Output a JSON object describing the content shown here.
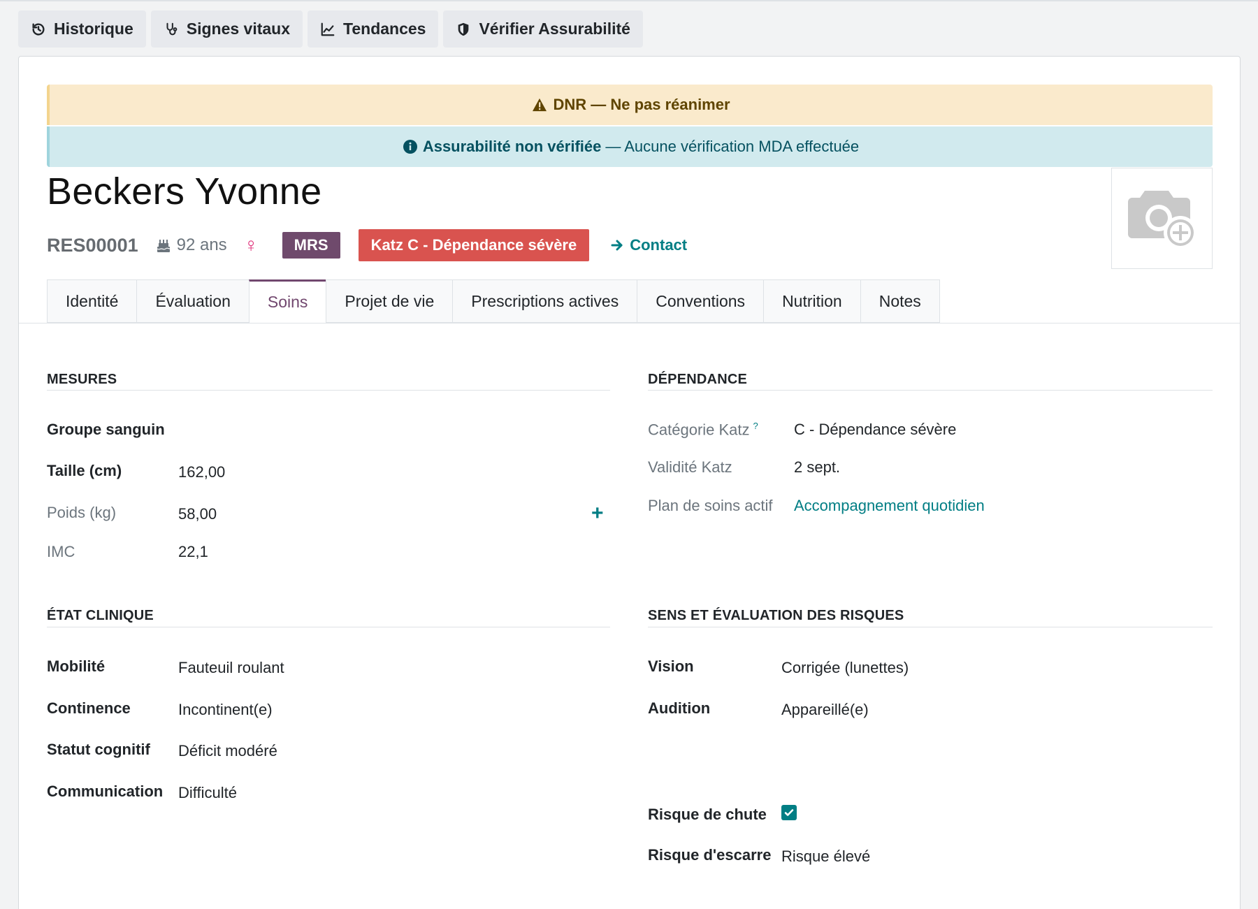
{
  "toolbar": {
    "history": "Historique",
    "vitals": "Signes vitaux",
    "trends": "Tendances",
    "insurability": "Vérifier Assurabilité"
  },
  "alerts": {
    "dnr": "DNR — Ne pas réanimer",
    "insurability_bold": "Assurabilité non vérifiée",
    "insurability_rest": "— Aucune vérification MDA effectuée"
  },
  "patient": {
    "name": "Beckers Yvonne",
    "ref": "RES00001",
    "age": "92 ans",
    "gender_symbol": "♀",
    "badge_type": "MRS",
    "badge_katz": "Katz C - Dépendance sévère",
    "contact": "Contact"
  },
  "tabs": [
    "Identité",
    "Évaluation",
    "Soins",
    "Projet de vie",
    "Prescriptions actives",
    "Conventions",
    "Nutrition",
    "Notes"
  ],
  "active_tab": "Soins",
  "mesures": {
    "title": "MESURES",
    "blood_group_label": "Groupe sanguin",
    "height_label": "Taille (cm)",
    "height_value": "162,00",
    "weight_label": "Poids (kg)",
    "weight_value": "58,00",
    "bmi_label": "IMC",
    "bmi_value": "22,1"
  },
  "dependance": {
    "title": "DÉPENDANCE",
    "katz_label": "Catégorie Katz",
    "katz_help": "?",
    "katz_value": "C - Dépendance sévère",
    "validity_label": "Validité Katz",
    "validity_value": "2 sept.",
    "plan_label": "Plan de soins actif",
    "plan_value": "Accompagnement quotidien"
  },
  "clinique": {
    "title": "ÉTAT CLINIQUE",
    "mobility_label": "Mobilité",
    "mobility_value": "Fauteuil roulant",
    "continence_label": "Continence",
    "continence_value": "Incontinent(e)",
    "cognitive_label": "Statut cognitif",
    "cognitive_value": "Déficit modéré",
    "communication_label": "Communication",
    "communication_value": "Difficulté"
  },
  "risques": {
    "title": "SENS ET ÉVALUATION DES RISQUES",
    "vision_label": "Vision",
    "vision_value": "Corrigée (lunettes)",
    "hearing_label": "Audition",
    "hearing_value": "Appareillé(e)",
    "fall_label": "Risque de chute",
    "fall_checked": true,
    "pressure_label": "Risque d'escarre",
    "pressure_value": "Risque élevé"
  },
  "colors": {
    "accent": "#017e84",
    "brand": "#71476e",
    "danger": "#d9534f"
  }
}
